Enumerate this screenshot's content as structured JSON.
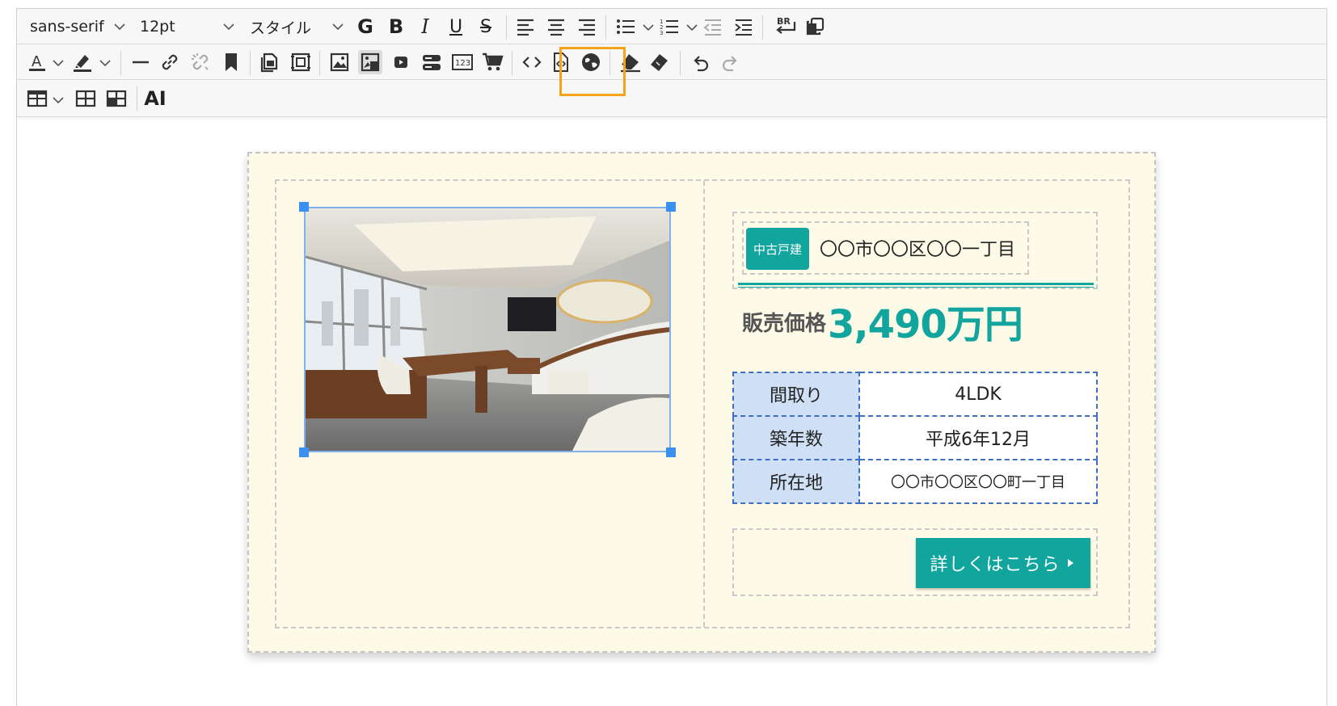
{
  "toolbar": {
    "font_family": "sans-serif",
    "font_size": "12pt",
    "style": "スタイル",
    "bold_g": "G",
    "bold_b": "B",
    "italic": "I",
    "underline": "U",
    "strike": "S",
    "br": "BR",
    "ai": "AI",
    "number_box": "123",
    "highlight_color": "#f7a21b"
  },
  "listing": {
    "badge": "中古戸建",
    "address": "〇〇市〇〇区〇〇一丁目",
    "price_label": "販売価格",
    "price": "3,490万円",
    "specs": [
      {
        "key": "間取り",
        "value": "4LDK"
      },
      {
        "key": "築年数",
        "value": "平成6年12月"
      },
      {
        "key": "所在地",
        "value": "〇〇市〇〇区〇〇町一丁目"
      }
    ],
    "more_button": "詳しくはこちら",
    "accent_color": "#11a59e"
  }
}
